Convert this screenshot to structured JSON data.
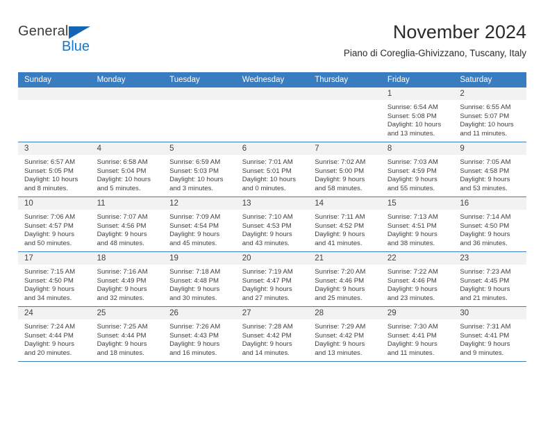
{
  "brand": {
    "name_part1": "General",
    "name_part2": "Blue",
    "triangle_icon": "triangle-icon",
    "colors": {
      "general": "#3c3c3c",
      "blue": "#1577c7",
      "triangle": "#1565b5"
    }
  },
  "header": {
    "title": "November 2024",
    "subtitle": "Piano di Coreglia-Ghivizzano, Tuscany, Italy"
  },
  "theme": {
    "header_blue": "#3a7cc0",
    "daynum_band": "#f2f2f2",
    "text": "#3d3d3d"
  },
  "weekdays": [
    "Sunday",
    "Monday",
    "Tuesday",
    "Wednesday",
    "Thursday",
    "Friday",
    "Saturday"
  ],
  "weeks": [
    [
      {
        "day": "",
        "sunrise": "",
        "sunset": "",
        "daylight1": "",
        "daylight2": ""
      },
      {
        "day": "",
        "sunrise": "",
        "sunset": "",
        "daylight1": "",
        "daylight2": ""
      },
      {
        "day": "",
        "sunrise": "",
        "sunset": "",
        "daylight1": "",
        "daylight2": ""
      },
      {
        "day": "",
        "sunrise": "",
        "sunset": "",
        "daylight1": "",
        "daylight2": ""
      },
      {
        "day": "",
        "sunrise": "",
        "sunset": "",
        "daylight1": "",
        "daylight2": ""
      },
      {
        "day": "1",
        "sunrise": "Sunrise: 6:54 AM",
        "sunset": "Sunset: 5:08 PM",
        "daylight1": "Daylight: 10 hours",
        "daylight2": "and 13 minutes."
      },
      {
        "day": "2",
        "sunrise": "Sunrise: 6:55 AM",
        "sunset": "Sunset: 5:07 PM",
        "daylight1": "Daylight: 10 hours",
        "daylight2": "and 11 minutes."
      }
    ],
    [
      {
        "day": "3",
        "sunrise": "Sunrise: 6:57 AM",
        "sunset": "Sunset: 5:05 PM",
        "daylight1": "Daylight: 10 hours",
        "daylight2": "and 8 minutes."
      },
      {
        "day": "4",
        "sunrise": "Sunrise: 6:58 AM",
        "sunset": "Sunset: 5:04 PM",
        "daylight1": "Daylight: 10 hours",
        "daylight2": "and 5 minutes."
      },
      {
        "day": "5",
        "sunrise": "Sunrise: 6:59 AM",
        "sunset": "Sunset: 5:03 PM",
        "daylight1": "Daylight: 10 hours",
        "daylight2": "and 3 minutes."
      },
      {
        "day": "6",
        "sunrise": "Sunrise: 7:01 AM",
        "sunset": "Sunset: 5:01 PM",
        "daylight1": "Daylight: 10 hours",
        "daylight2": "and 0 minutes."
      },
      {
        "day": "7",
        "sunrise": "Sunrise: 7:02 AM",
        "sunset": "Sunset: 5:00 PM",
        "daylight1": "Daylight: 9 hours",
        "daylight2": "and 58 minutes."
      },
      {
        "day": "8",
        "sunrise": "Sunrise: 7:03 AM",
        "sunset": "Sunset: 4:59 PM",
        "daylight1": "Daylight: 9 hours",
        "daylight2": "and 55 minutes."
      },
      {
        "day": "9",
        "sunrise": "Sunrise: 7:05 AM",
        "sunset": "Sunset: 4:58 PM",
        "daylight1": "Daylight: 9 hours",
        "daylight2": "and 53 minutes."
      }
    ],
    [
      {
        "day": "10",
        "sunrise": "Sunrise: 7:06 AM",
        "sunset": "Sunset: 4:57 PM",
        "daylight1": "Daylight: 9 hours",
        "daylight2": "and 50 minutes."
      },
      {
        "day": "11",
        "sunrise": "Sunrise: 7:07 AM",
        "sunset": "Sunset: 4:56 PM",
        "daylight1": "Daylight: 9 hours",
        "daylight2": "and 48 minutes."
      },
      {
        "day": "12",
        "sunrise": "Sunrise: 7:09 AM",
        "sunset": "Sunset: 4:54 PM",
        "daylight1": "Daylight: 9 hours",
        "daylight2": "and 45 minutes."
      },
      {
        "day": "13",
        "sunrise": "Sunrise: 7:10 AM",
        "sunset": "Sunset: 4:53 PM",
        "daylight1": "Daylight: 9 hours",
        "daylight2": "and 43 minutes."
      },
      {
        "day": "14",
        "sunrise": "Sunrise: 7:11 AM",
        "sunset": "Sunset: 4:52 PM",
        "daylight1": "Daylight: 9 hours",
        "daylight2": "and 41 minutes."
      },
      {
        "day": "15",
        "sunrise": "Sunrise: 7:13 AM",
        "sunset": "Sunset: 4:51 PM",
        "daylight1": "Daylight: 9 hours",
        "daylight2": "and 38 minutes."
      },
      {
        "day": "16",
        "sunrise": "Sunrise: 7:14 AM",
        "sunset": "Sunset: 4:50 PM",
        "daylight1": "Daylight: 9 hours",
        "daylight2": "and 36 minutes."
      }
    ],
    [
      {
        "day": "17",
        "sunrise": "Sunrise: 7:15 AM",
        "sunset": "Sunset: 4:50 PM",
        "daylight1": "Daylight: 9 hours",
        "daylight2": "and 34 minutes."
      },
      {
        "day": "18",
        "sunrise": "Sunrise: 7:16 AM",
        "sunset": "Sunset: 4:49 PM",
        "daylight1": "Daylight: 9 hours",
        "daylight2": "and 32 minutes."
      },
      {
        "day": "19",
        "sunrise": "Sunrise: 7:18 AM",
        "sunset": "Sunset: 4:48 PM",
        "daylight1": "Daylight: 9 hours",
        "daylight2": "and 30 minutes."
      },
      {
        "day": "20",
        "sunrise": "Sunrise: 7:19 AM",
        "sunset": "Sunset: 4:47 PM",
        "daylight1": "Daylight: 9 hours",
        "daylight2": "and 27 minutes."
      },
      {
        "day": "21",
        "sunrise": "Sunrise: 7:20 AM",
        "sunset": "Sunset: 4:46 PM",
        "daylight1": "Daylight: 9 hours",
        "daylight2": "and 25 minutes."
      },
      {
        "day": "22",
        "sunrise": "Sunrise: 7:22 AM",
        "sunset": "Sunset: 4:46 PM",
        "daylight1": "Daylight: 9 hours",
        "daylight2": "and 23 minutes."
      },
      {
        "day": "23",
        "sunrise": "Sunrise: 7:23 AM",
        "sunset": "Sunset: 4:45 PM",
        "daylight1": "Daylight: 9 hours",
        "daylight2": "and 21 minutes."
      }
    ],
    [
      {
        "day": "24",
        "sunrise": "Sunrise: 7:24 AM",
        "sunset": "Sunset: 4:44 PM",
        "daylight1": "Daylight: 9 hours",
        "daylight2": "and 20 minutes."
      },
      {
        "day": "25",
        "sunrise": "Sunrise: 7:25 AM",
        "sunset": "Sunset: 4:44 PM",
        "daylight1": "Daylight: 9 hours",
        "daylight2": "and 18 minutes."
      },
      {
        "day": "26",
        "sunrise": "Sunrise: 7:26 AM",
        "sunset": "Sunset: 4:43 PM",
        "daylight1": "Daylight: 9 hours",
        "daylight2": "and 16 minutes."
      },
      {
        "day": "27",
        "sunrise": "Sunrise: 7:28 AM",
        "sunset": "Sunset: 4:42 PM",
        "daylight1": "Daylight: 9 hours",
        "daylight2": "and 14 minutes."
      },
      {
        "day": "28",
        "sunrise": "Sunrise: 7:29 AM",
        "sunset": "Sunset: 4:42 PM",
        "daylight1": "Daylight: 9 hours",
        "daylight2": "and 13 minutes."
      },
      {
        "day": "29",
        "sunrise": "Sunrise: 7:30 AM",
        "sunset": "Sunset: 4:41 PM",
        "daylight1": "Daylight: 9 hours",
        "daylight2": "and 11 minutes."
      },
      {
        "day": "30",
        "sunrise": "Sunrise: 7:31 AM",
        "sunset": "Sunset: 4:41 PM",
        "daylight1": "Daylight: 9 hours",
        "daylight2": "and 9 minutes."
      }
    ]
  ]
}
